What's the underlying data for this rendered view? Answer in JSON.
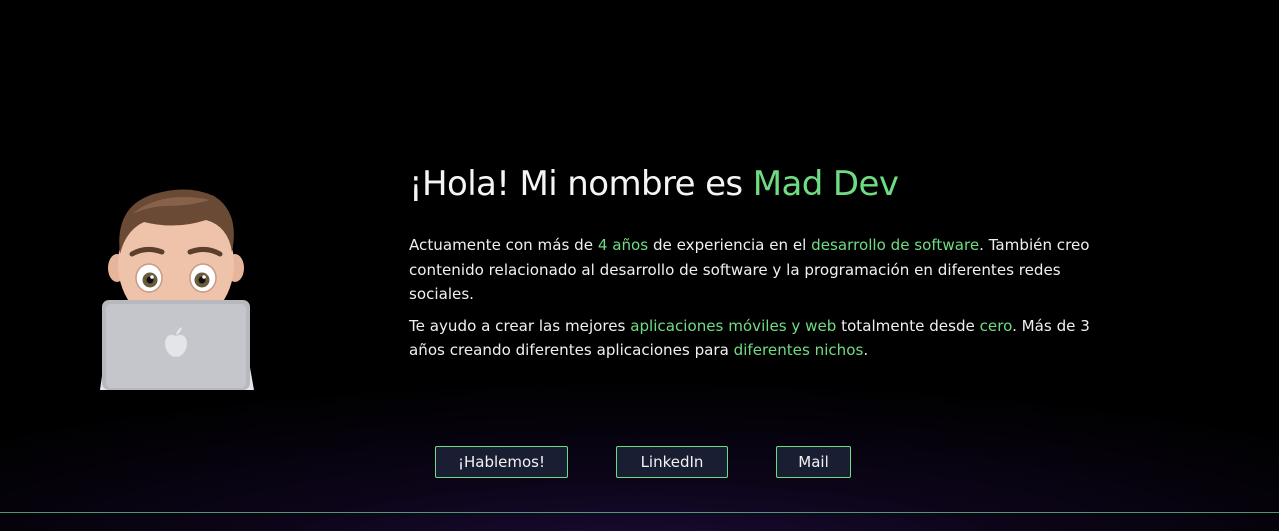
{
  "colors": {
    "accent": "#6fdc82",
    "background": "#000000",
    "button_bg": "#1a1e33"
  },
  "hero": {
    "avatar_icon": "memoji-developer-with-laptop",
    "title_prefix": "¡Hola! Mi nombre es ",
    "title_name": "Mad Dev",
    "para1": {
      "t1": "Actuamente con más de ",
      "h1": "4 años",
      "t2": " de experiencia en el ",
      "h2": "desarrollo de software",
      "t3": ". También creo contenido relacionado al desarrollo de software y la programación en diferentes redes sociales."
    },
    "para2": {
      "t1": "Te ayudo a crear las mejores ",
      "h1": "aplicaciones móviles y web",
      "t2": " totalmente desde ",
      "h2": "cero",
      "t3": ". Más de 3 años creando diferentes aplicaciones para ",
      "h3": "diferentes nichos",
      "t4": "."
    }
  },
  "buttons": {
    "talk": "¡Hablemos!",
    "linkedin": "LinkedIn",
    "mail": "Mail"
  }
}
